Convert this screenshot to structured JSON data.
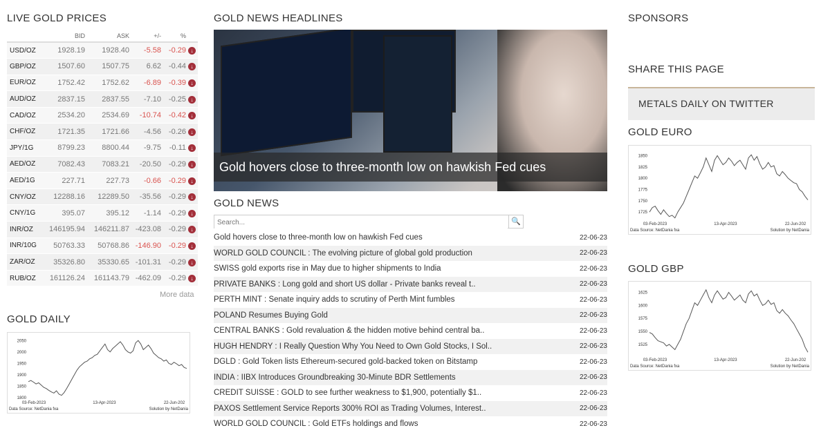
{
  "left": {
    "title": "LIVE GOLD PRICES",
    "columns": [
      "BID",
      "ASK",
      "+/-",
      "%"
    ],
    "rows": [
      {
        "sym": "USD/OZ",
        "bid": "1928.19",
        "ask": "1928.40",
        "chg": "-5.58",
        "pct": "-0.29",
        "neg": true
      },
      {
        "sym": "GBP/OZ",
        "bid": "1507.60",
        "ask": "1507.75",
        "chg": "6.62",
        "pct": "-0.44",
        "neg": false
      },
      {
        "sym": "EUR/OZ",
        "bid": "1752.42",
        "ask": "1752.62",
        "chg": "-6.89",
        "pct": "-0.39",
        "neg": true
      },
      {
        "sym": "AUD/OZ",
        "bid": "2837.15",
        "ask": "2837.55",
        "chg": "-7.10",
        "pct": "-0.25",
        "neg": false
      },
      {
        "sym": "CAD/OZ",
        "bid": "2534.20",
        "ask": "2534.69",
        "chg": "-10.74",
        "pct": "-0.42",
        "neg": true
      },
      {
        "sym": "CHF/OZ",
        "bid": "1721.35",
        "ask": "1721.66",
        "chg": "-4.56",
        "pct": "-0.26",
        "neg": false
      },
      {
        "sym": "JPY/1G",
        "bid": "8799.23",
        "ask": "8800.44",
        "chg": "-9.75",
        "pct": "-0.11",
        "neg": false
      },
      {
        "sym": "AED/OZ",
        "bid": "7082.43",
        "ask": "7083.21",
        "chg": "-20.50",
        "pct": "-0.29",
        "neg": false
      },
      {
        "sym": "AED/1G",
        "bid": "227.71",
        "ask": "227.73",
        "chg": "-0.66",
        "pct": "-0.29",
        "neg": true
      },
      {
        "sym": "CNY/OZ",
        "bid": "12288.16",
        "ask": "12289.50",
        "chg": "-35.56",
        "pct": "-0.29",
        "neg": false
      },
      {
        "sym": "CNY/1G",
        "bid": "395.07",
        "ask": "395.12",
        "chg": "-1.14",
        "pct": "-0.29",
        "neg": false
      },
      {
        "sym": "INR/OZ",
        "bid": "146195.94",
        "ask": "146211.87",
        "chg": "-423.08",
        "pct": "-0.29",
        "neg": false
      },
      {
        "sym": "INR/10G",
        "bid": "50763.33",
        "ask": "50768.86",
        "chg": "-146.90",
        "pct": "-0.29",
        "neg": true
      },
      {
        "sym": "ZAR/OZ",
        "bid": "35326.80",
        "ask": "35330.65",
        "chg": "-101.31",
        "pct": "-0.29",
        "neg": false
      },
      {
        "sym": "RUB/OZ",
        "bid": "161126.24",
        "ask": "161143.79",
        "chg": "-462.09",
        "pct": "-0.29",
        "neg": false
      }
    ],
    "more": "More data",
    "daily_title": "GOLD DAILY"
  },
  "middle": {
    "headlines_title": "GOLD NEWS HEADLINES",
    "hero_caption": "Gold hovers close to three-month low on hawkish Fed cues",
    "news_title": "GOLD NEWS",
    "search_placeholder": "Search...",
    "news": [
      {
        "title": "Gold hovers close to three-month low on hawkish Fed cues",
        "date": "22-06-23"
      },
      {
        "title": "WORLD GOLD COUNCIL : The evolving picture of global gold production",
        "date": "22-06-23"
      },
      {
        "title": "SWISS gold exports rise in May due to higher shipments to India",
        "date": "22-06-23"
      },
      {
        "title": "PRIVATE BANKS : Long gold and short US dollar - Private banks reveal t..",
        "date": "22-06-23"
      },
      {
        "title": "PERTH MINT : Senate inquiry adds to scrutiny of Perth Mint fumbles",
        "date": "22-06-23"
      },
      {
        "title": "POLAND Resumes Buying Gold",
        "date": "22-06-23"
      },
      {
        "title": "CENTRAL BANKS : Gold revaluation & the hidden motive behind central ba..",
        "date": "22-06-23"
      },
      {
        "title": "HUGH HENDRY : I Really Question Why You Need to Own Gold Stocks, I Sol..",
        "date": "22-06-23"
      },
      {
        "title": "DGLD : Gold Token lists Ethereum-secured gold-backed token on Bitstamp",
        "date": "22-06-23"
      },
      {
        "title": "INDIA : IIBX Introduces Groundbreaking 30-Minute BDR Settlements",
        "date": "22-06-23"
      },
      {
        "title": "CREDIT SUISSE : GOLD to see further weakness to $1,900, potentially $1..",
        "date": "22-06-23"
      },
      {
        "title": "PAXOS Settlement Service Reports 300% ROI as Trading Volumes, Interest..",
        "date": "22-06-23"
      },
      {
        "title": "WORLD GOLD COUNCIL : Gold ETFs holdings and flows",
        "date": "22-06-23"
      }
    ]
  },
  "right": {
    "sponsors": "SPONSORS",
    "share": "SHARE THIS PAGE",
    "twitter": "METALS DAILY ON TWITTER",
    "euro_title": "GOLD EURO",
    "gbp_title": "GOLD GBP"
  },
  "chart_data": [
    {
      "type": "line",
      "title": "GOLD DAILY",
      "x_ticks": [
        "03-Feb-2023",
        "13-Apr-2023",
        "22-Jun-202"
      ],
      "y_ticks": [
        1800,
        1850,
        1900,
        1950,
        2000,
        2050
      ],
      "ylim": [
        1800,
        2060
      ],
      "values": [
        1870,
        1875,
        1868,
        1860,
        1865,
        1855,
        1845,
        1840,
        1832,
        1825,
        1820,
        1830,
        1815,
        1810,
        1822,
        1840,
        1860,
        1880,
        1900,
        1920,
        1935,
        1945,
        1955,
        1960,
        1970,
        1975,
        1985,
        1990,
        2005,
        2020,
        2035,
        2010,
        2000,
        2015,
        2025,
        2035,
        2045,
        2030,
        2010,
        2000,
        1995,
        2005,
        2040,
        2050,
        2035,
        2010,
        2020,
        2030,
        2015,
        1995,
        1985,
        1975,
        1970,
        1960,
        1965,
        1950,
        1945,
        1955,
        1948,
        1940,
        1945,
        1932,
        1928
      ],
      "footer_left": "Data Source: NetDania fxa",
      "footer_right": "Solution by NetDania"
    },
    {
      "type": "line",
      "title": "GOLD EURO",
      "x_ticks": [
        "03-Feb-2023",
        "13-Apr-2023",
        "22-Jun-202"
      ],
      "y_ticks": [
        1725,
        1750,
        1775,
        1800,
        1825,
        1850
      ],
      "ylim": [
        1710,
        1860
      ],
      "values": [
        1725,
        1735,
        1738,
        1728,
        1720,
        1730,
        1722,
        1715,
        1718,
        1712,
        1725,
        1735,
        1745,
        1760,
        1775,
        1790,
        1805,
        1800,
        1812,
        1825,
        1845,
        1830,
        1815,
        1840,
        1850,
        1840,
        1830,
        1835,
        1845,
        1838,
        1828,
        1835,
        1840,
        1830,
        1820,
        1845,
        1852,
        1840,
        1848,
        1832,
        1820,
        1825,
        1835,
        1825,
        1828,
        1810,
        1805,
        1815,
        1808,
        1800,
        1795,
        1790,
        1788,
        1775,
        1770,
        1760,
        1752
      ],
      "footer_left": "Data Source: NetDania fxa",
      "footer_right": "Solution by NetDania"
    },
    {
      "type": "line",
      "title": "GOLD GBP",
      "x_ticks": [
        "03-Feb-2023",
        "13-Apr-2023",
        "22-Jun-202"
      ],
      "y_ticks": [
        1525,
        1550,
        1575,
        1600,
        1625
      ],
      "ylim": [
        1505,
        1635
      ],
      "values": [
        1548,
        1545,
        1538,
        1532,
        1530,
        1528,
        1522,
        1525,
        1520,
        1515,
        1525,
        1535,
        1550,
        1565,
        1575,
        1590,
        1605,
        1600,
        1610,
        1620,
        1630,
        1615,
        1605,
        1620,
        1628,
        1620,
        1612,
        1615,
        1625,
        1618,
        1610,
        1615,
        1620,
        1610,
        1605,
        1622,
        1628,
        1618,
        1622,
        1610,
        1600,
        1603,
        1610,
        1602,
        1605,
        1590,
        1585,
        1592,
        1585,
        1580,
        1572,
        1565,
        1555,
        1545,
        1535,
        1520,
        1510
      ],
      "footer_left": "Data Source: NetDania fxa",
      "footer_right": "Solution by NetDania"
    }
  ]
}
